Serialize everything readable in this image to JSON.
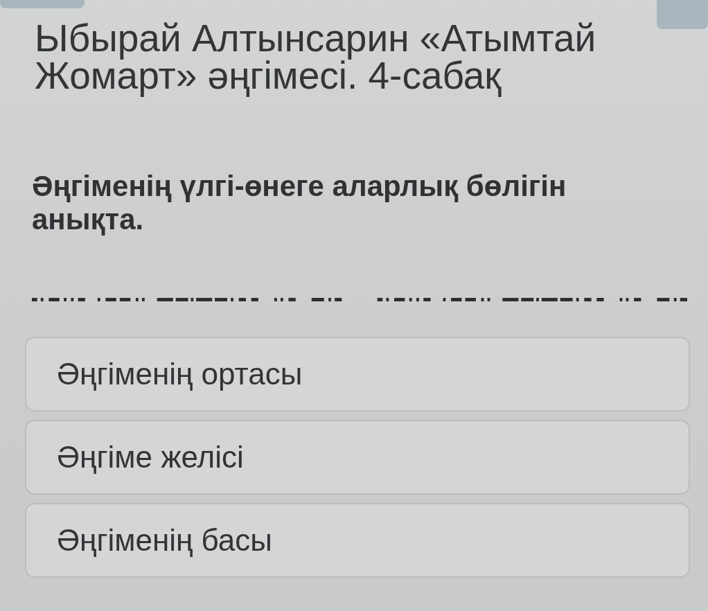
{
  "title": "Ыбырай Алтынсарин «Атымтай Жомарт» әңгімесі. 4-сабақ",
  "question": {
    "text": "Әңгіменің үлгі-өнеге аларлық бөлігін анықта."
  },
  "options": [
    {
      "label": "Әңгіменің ортасы",
      "selected": false
    },
    {
      "label": "Әңгіме желісі",
      "selected": false
    },
    {
      "label": "Әңгіменің басы",
      "selected": false
    }
  ]
}
